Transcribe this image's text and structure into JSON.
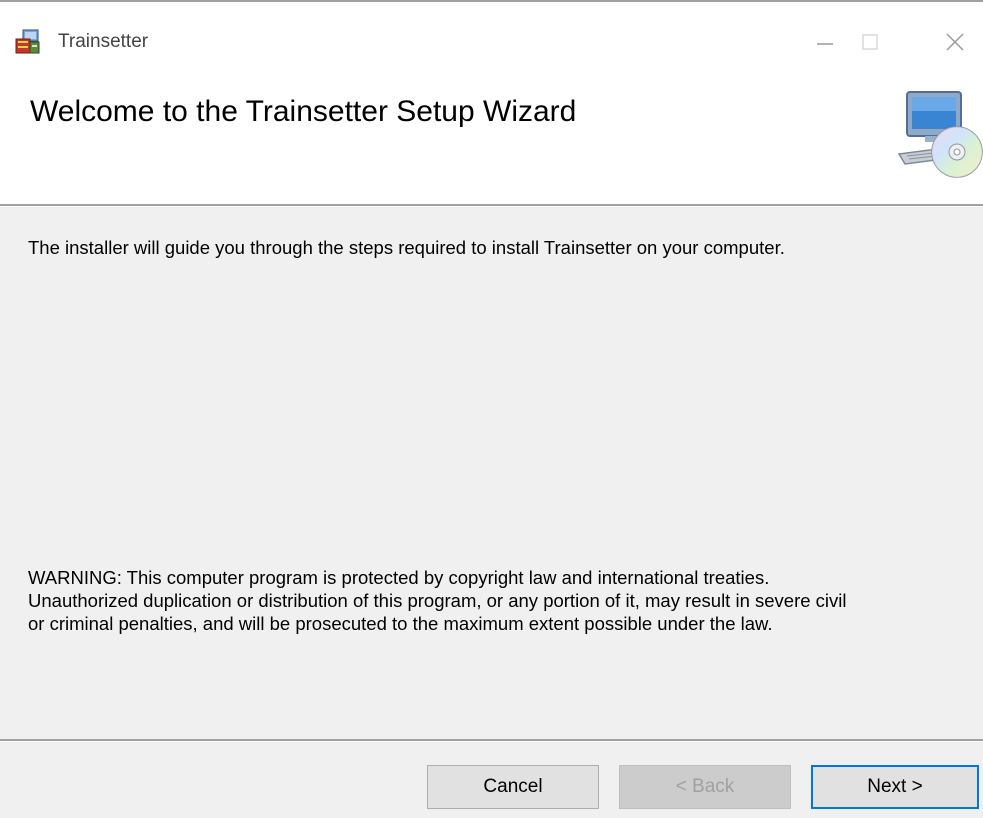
{
  "window": {
    "title": "Trainsetter",
    "icon": "installer-package-icon",
    "controls": [
      "minimize-icon",
      "maximize-icon",
      "close-icon"
    ]
  },
  "header": {
    "title": "Welcome to the Trainsetter Setup Wizard",
    "graphic": "computer-with-cd-icon"
  },
  "body": {
    "intro": "The installer will guide you through the steps required to install Trainsetter on your computer.",
    "warning_line1": "WARNING: This computer program is protected by copyright law and international treaties.",
    "warning_line2": "Unauthorized duplication or distribution of this program, or any portion of it, may result in severe civil",
    "warning_line3": "or criminal penalties, and will be prosecuted to the maximum extent possible under the law."
  },
  "buttons": {
    "cancel": "Cancel",
    "back": "< Back",
    "back_enabled": false,
    "next": "Next >",
    "next_default": true
  },
  "colors": {
    "accent": "#0078d7",
    "window_bg": "#f0f0f0",
    "header_bg": "#ffffff"
  }
}
